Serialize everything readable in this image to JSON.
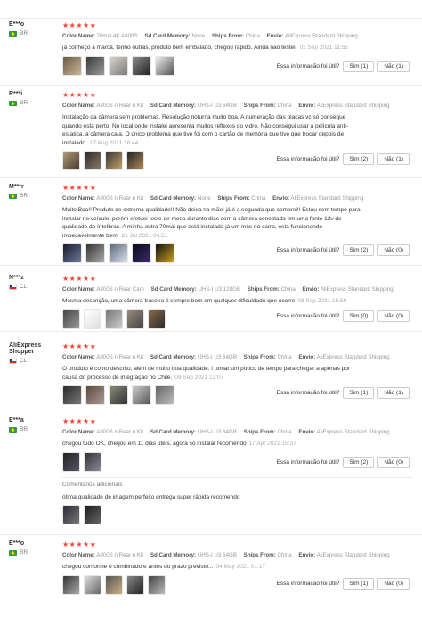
{
  "labels": {
    "color_name": "Color Name:",
    "sd_card_memory": "Sd Card Memory:",
    "ships_from": "Ships From:",
    "envio": "Envio:",
    "helpful_q": "Essa informação foi útil?",
    "extra_comments": "Comentários adicionais"
  },
  "reviews": [
    {
      "user": "E***o",
      "country": "BR",
      "stars": "★★★★★",
      "color": "70mai 4K A800S",
      "memory": "None",
      "ships": "China",
      "envio": "AliExpress Standard Shipping",
      "text": "já conheço a marca, tenho outras. produto bem embalado, chegou rápido. Ainda não testei.",
      "date": "01 Sep 2021 11:55",
      "yes": "Sim (1)",
      "no": "Não (1)"
    },
    {
      "user": "R***i",
      "country": "BR",
      "stars": "★★★★★",
      "color": "A800S n Rear n Kit",
      "memory": "UHS-I U3 64GB",
      "ships": "China",
      "envio": "AliExpress Standard Shipping",
      "text": "Instalação da câmera sem problemas. Resolução noturna muito boa. A numeração das placas vc só consegue quando está perto. No local onde instalei apresenta muitos reflexos do vidro. Não consegui usar a película anti-estatica, a câmera caia. O único problema que tive foi com o cartão de memória que tive que trocar depois de instalado.",
      "date": "17 Aug 2021 16:44",
      "yes": "Sim (2)",
      "no": "Não (1)"
    },
    {
      "user": "M***r",
      "country": "BR",
      "stars": "★★★★★",
      "color": "A800S n Rear n Kit",
      "memory": "None",
      "ships": "China",
      "envio": "AliExpress Standard Shipping",
      "text": "Muito Boa!! Produto de extrema qualidade!! Não deixa na mão! já é a segunda que comprei!! Estou sem tempo para instalar no veículo, porém efetuei teste de mesa durante dias com a câmera conectada em uma fonte 12v de qualidade da Intelbras. A minha outra 70mai que está instalada já um mês no carro, está funcionando impecavelmente bem!",
      "date": "21 Jul 2021 04:51",
      "yes": "Sim (2)",
      "no": "Não (0)"
    },
    {
      "user": "N***z",
      "country": "CL",
      "stars": "★★★★★",
      "color": "A800S n Rear Cam",
      "memory": "UHS-I U3 128GB",
      "ships": "China",
      "envio": "AliExpress Standard Shipping",
      "text": "Mesma descrição, uma câmera traseira é sempre bom em qualquer dificuldade que ocorre",
      "date": "08 Sep 2021 16:59",
      "yes": "Sim (0)",
      "no": "Não (0)"
    },
    {
      "user": "AliExpress Shopper",
      "country": "CL",
      "stars": "★★★★★",
      "color": "A800S n Rear n Kit",
      "memory": "UHS-I U3 64GB",
      "ships": "China",
      "envio": "AliExpress Standard Shipping",
      "text": "O produto é como descrito, além de muito boa qualidade. I tomar um pouco de tempo para chegar a apenas por causa do processo de integração no Chile.",
      "date": "09 Sep 2021 12:07",
      "yes": "Sim (1)",
      "no": "Não (1)"
    },
    {
      "user": "E***a",
      "country": "BR",
      "stars": "★★★★★",
      "color": "A800S n Rear n Kit",
      "memory": "UHS-I U3 64GB",
      "ships": "China",
      "envio": "AliExpress Standard Shipping",
      "text": "chegou tudo OK, chegou em 11 dias úteis. agora só instalar recomendo",
      "date": "17 Apr 2021 15:37",
      "yes": "Sim (2)",
      "no": "Não (0)",
      "extra_text": "ótima qualidade de imagem perfeito entrega super rápida recomendo"
    },
    {
      "user": "E***o",
      "country": "BR",
      "stars": "★★★★★",
      "color": "A800S n Rear n Kit",
      "memory": "UHS-I U3 64GB",
      "ships": "China",
      "envio": "AliExpress Standard Shipping",
      "text": "chegou conforme o combinado e antes do prazo previsto...",
      "date": "04 May 2021 01:17",
      "yes": "Sim (1)",
      "no": "Não (0)"
    }
  ]
}
